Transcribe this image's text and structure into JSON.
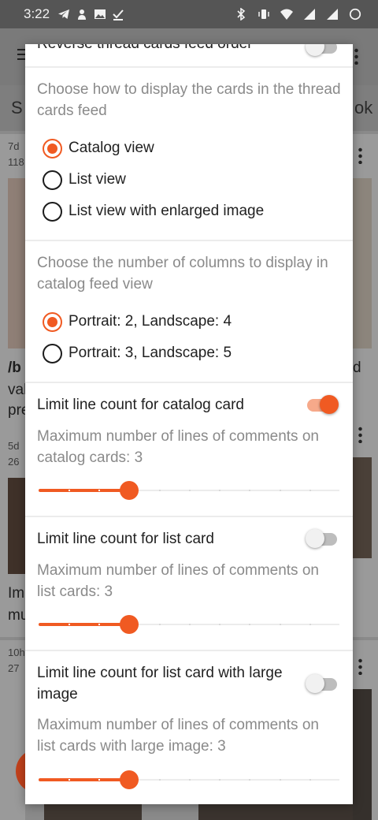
{
  "status_bar": {
    "time": "3:22",
    "left_icons": [
      "telegram-icon",
      "notification-icon",
      "image-icon",
      "check-icon"
    ],
    "right_icons": [
      "bluetooth-icon",
      "vibrate-icon",
      "wifi-icon",
      "signal-icon",
      "signal-icon-2",
      "battery-icon"
    ]
  },
  "background": {
    "tab_left": "S",
    "tab_right": "ok",
    "card1_meta": "7d",
    "card1_meta2": "118",
    "card2_meta": "5d",
    "card2_meta2": "26",
    "card3_meta": "10h",
    "card3_meta2": "27",
    "card1_title": "/b",
    "card1_line2": "val",
    "card1_line3": "pre",
    "card2_title": "Im",
    "card2_line2": "mu",
    "card_right_fragment": "d"
  },
  "dialog": {
    "top_item_label": "Reverse thread cards feed order",
    "top_item_on": false,
    "display_mode": {
      "description": "Choose how to display the cards in the thread cards feed",
      "options": [
        {
          "label": "Catalog view",
          "selected": true
        },
        {
          "label": "List view",
          "selected": false
        },
        {
          "label": "List view with enlarged image",
          "selected": false
        }
      ]
    },
    "columns": {
      "description": "Choose the number of columns to display in catalog feed view",
      "options": [
        {
          "label": "Portrait: 2, Landscape: 4",
          "selected": true
        },
        {
          "label": "Portrait: 3, Landscape: 5",
          "selected": false
        }
      ]
    },
    "catalog_limit": {
      "label": "Limit line count for catalog card",
      "on": true,
      "description": "Maximum number of lines of comments on catalog cards: 3",
      "slider_fraction": 0.3
    },
    "list_limit": {
      "label": "Limit line count for list card",
      "on": false,
      "description": "Maximum number of lines of comments on list cards: 3",
      "slider_fraction": 0.3
    },
    "list_large_limit": {
      "label": "Limit line count for list card with large image",
      "on": false,
      "description": "Maximum number of lines of comments on list cards with large image: 3",
      "slider_fraction": 0.3
    }
  },
  "colors": {
    "accent": "#f05a22",
    "accent_track": "#f6a98a",
    "text_primary": "#212121",
    "text_secondary": "#8a8a8a"
  }
}
